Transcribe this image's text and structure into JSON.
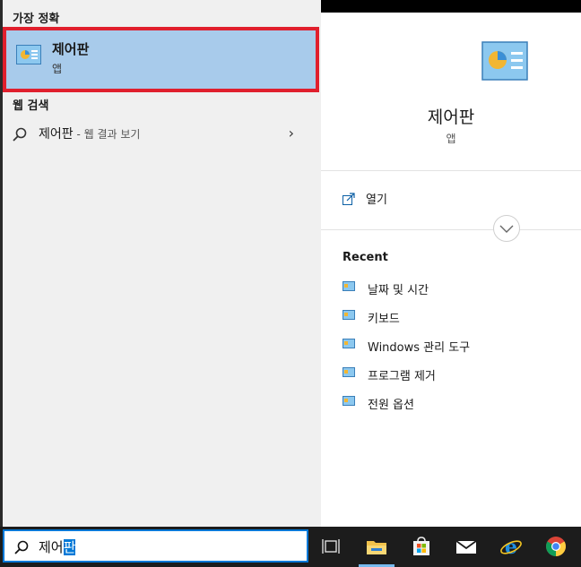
{
  "best_match": {
    "heading": "가장 정확",
    "name": "제어판",
    "type": "앱"
  },
  "web_search": {
    "heading": "웹 검색",
    "query": "제어판",
    "suffix": " - 웹 결과 보기",
    "chevron": "›"
  },
  "details": {
    "title": "제어판",
    "subtitle": "앱",
    "open_label": "열기",
    "recent_heading": "Recent",
    "recent_items": [
      {
        "label": "날짜 및 시간"
      },
      {
        "label": "키보드"
      },
      {
        "label": "Windows 관리 도구"
      },
      {
        "label": "프로그램 제거"
      },
      {
        "label": "전원 옵션"
      }
    ]
  },
  "taskbar": {
    "search_text": "제어",
    "search_selected": "판",
    "icons": [
      "task-view-icon",
      "file-explorer-icon",
      "microsoft-store-icon",
      "mail-icon",
      "internet-explorer-icon",
      "chrome-icon"
    ]
  },
  "colors": {
    "accent": "#0078d7",
    "highlight": "#a8cbeb",
    "annotation_red": "#e01f2d"
  }
}
